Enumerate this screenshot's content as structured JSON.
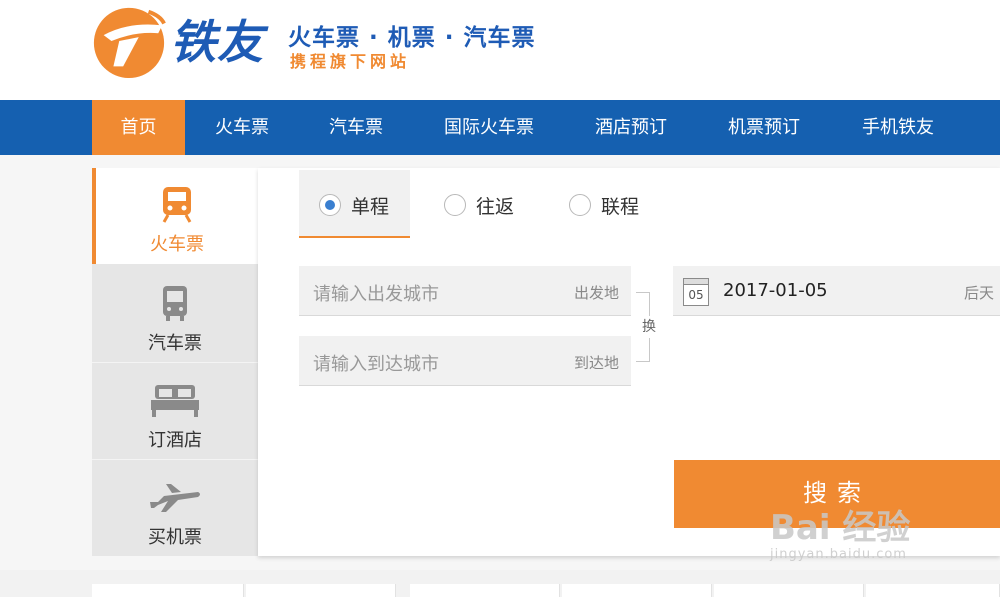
{
  "header": {
    "logo_text": "铁友",
    "tagline": "火车票 · 机票 · 汽车票",
    "subtagline": "携程旗下网站",
    "brand_colors": {
      "blue": "#1e5bb5",
      "orange": "#f08a32"
    }
  },
  "nav": {
    "items": [
      {
        "label": "首页",
        "active": true
      },
      {
        "label": "火车票"
      },
      {
        "label": "汽车票"
      },
      {
        "label": "国际火车票"
      },
      {
        "label": "酒店预订"
      },
      {
        "label": "机票预订"
      },
      {
        "label": "手机铁友"
      }
    ]
  },
  "sidebar": {
    "items": [
      {
        "label": "火车票",
        "icon": "train-icon",
        "active": true
      },
      {
        "label": "汽车票",
        "icon": "bus-icon"
      },
      {
        "label": "订酒店",
        "icon": "bed-icon"
      },
      {
        "label": "买机票",
        "icon": "plane-icon"
      }
    ]
  },
  "search": {
    "trip_types": [
      {
        "label": "单程",
        "selected": true
      },
      {
        "label": "往返"
      },
      {
        "label": "联程"
      }
    ],
    "from": {
      "placeholder": "请输入出发城市",
      "tag": "出发地"
    },
    "to": {
      "placeholder": "请输入到达城市",
      "tag": "到达地"
    },
    "swap_label": "换",
    "date": {
      "calendar_day": "05",
      "value": "2017-01-05",
      "relative": "后天"
    },
    "submit_label": "搜索"
  },
  "watermark": {
    "main": "Bai 经验",
    "sub": "jingyan.baidu.com"
  }
}
